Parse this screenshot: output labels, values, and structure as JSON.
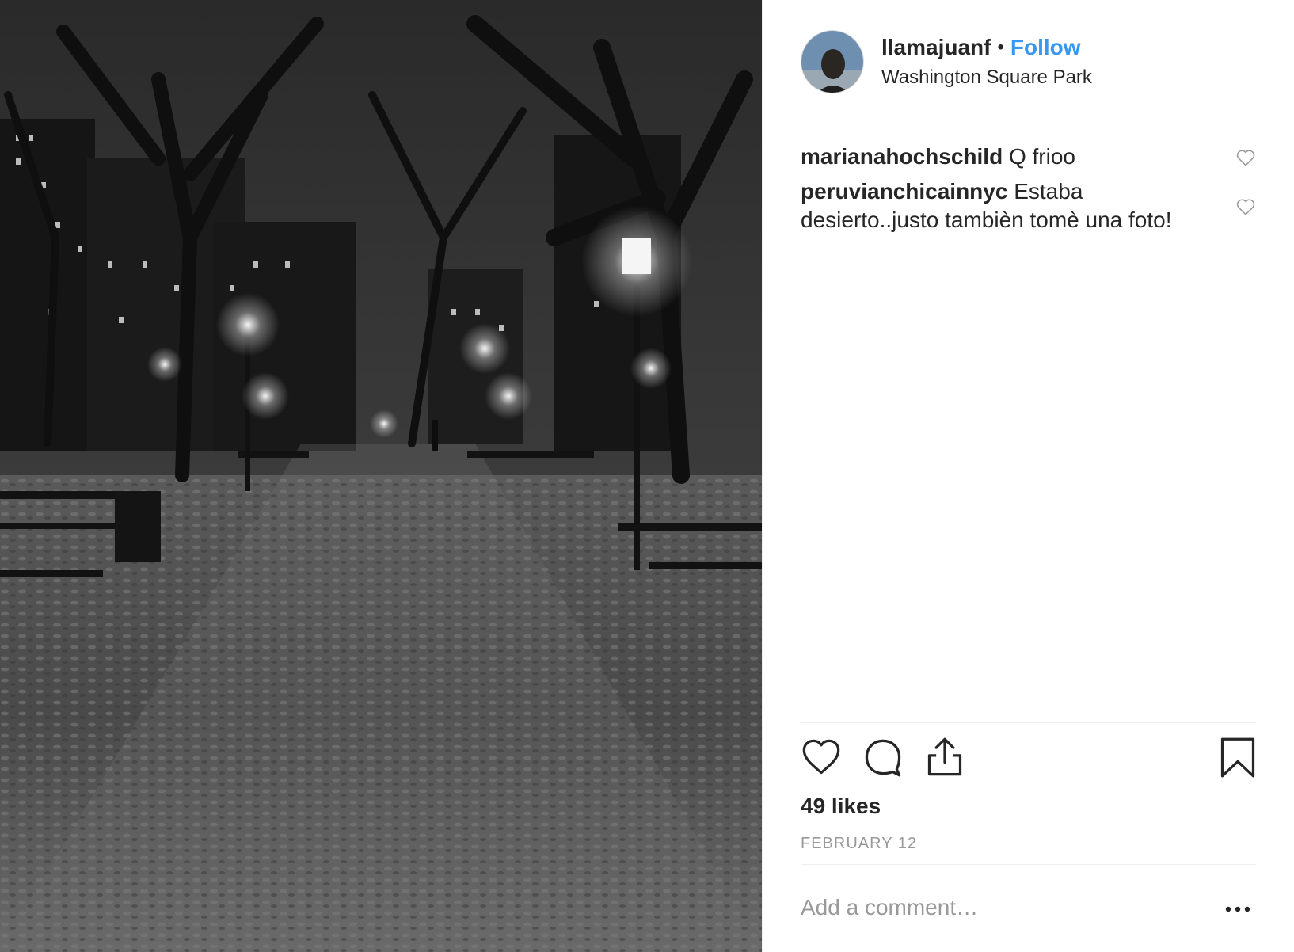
{
  "post": {
    "photo_description_icon": "photo-night-park",
    "user": {
      "username": "llamajuanf",
      "separator": "•",
      "follow_label": "Follow",
      "location": "Washington Square Park",
      "avatar_icon": "avatar-icon"
    },
    "comments": [
      {
        "author": "marianahochschild",
        "text": "Q frioo"
      },
      {
        "author": "peruvianchicainnyc",
        "text": "Estaba desierto..justo tambièn tomè una foto!"
      }
    ],
    "actions": {
      "like_icon": "heart-icon",
      "comment_icon": "comment-bubble-icon",
      "share_icon": "share-icon",
      "save_icon": "bookmark-icon",
      "more_icon": "more-dots-icon"
    },
    "likes_text": "49 likes",
    "date_text": "FEBRUARY 12",
    "add_comment_placeholder": "Add a comment…"
  },
  "colors": {
    "follow": "#3897f0",
    "text": "#262626",
    "muted": "#999999",
    "divider": "#efefef"
  }
}
